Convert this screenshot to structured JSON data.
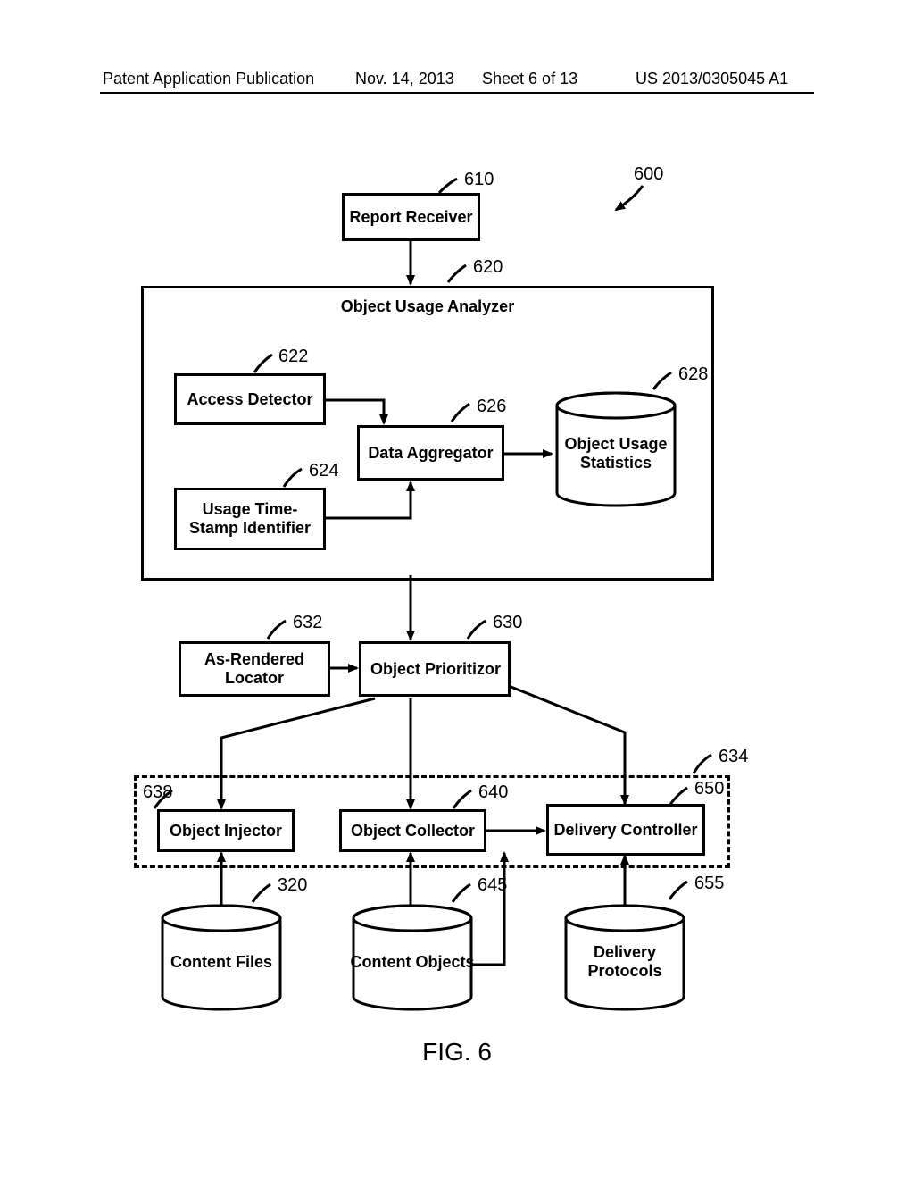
{
  "header": {
    "left": "Patent Application Publication",
    "date": "Nov. 14, 2013",
    "sheet": "Sheet 6 of 13",
    "pubno": "US 2013/0305045 A1"
  },
  "figure": {
    "caption": "FIG. 6",
    "overall_ref": "600"
  },
  "blocks": {
    "report_receiver": {
      "label": "Report Receiver",
      "ref": "610"
    },
    "object_usage_analyzer": {
      "label": "Object Usage Analyzer",
      "ref": "620"
    },
    "access_detector": {
      "label": "Access Detector",
      "ref": "622"
    },
    "usage_time_stamp_identifier": {
      "label": "Usage Time-Stamp Identifier",
      "ref": "624"
    },
    "data_aggregator": {
      "label": "Data Aggregator",
      "ref": "626"
    },
    "object_usage_statistics": {
      "label": "Object Usage Statistics",
      "ref": "628"
    },
    "as_rendered_locator": {
      "label": "As-Rendered Locator",
      "ref": "632"
    },
    "object_prioritizor": {
      "label": "Object Prioritizor",
      "ref": "630"
    },
    "delivery_group": {
      "ref": "634"
    },
    "object_injector": {
      "label": "Object Injector",
      "ref": "638"
    },
    "object_collector": {
      "label": "Object Collector",
      "ref": "640"
    },
    "delivery_controller": {
      "label": "Delivery Controller",
      "ref": "650"
    },
    "content_files": {
      "label": "Content Files",
      "ref": "320"
    },
    "content_objects": {
      "label": "Content Objects",
      "ref": "645"
    },
    "delivery_protocols": {
      "label": "Delivery Protocols",
      "ref": "655"
    }
  }
}
